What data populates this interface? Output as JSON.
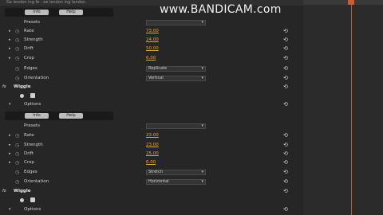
{
  "watermark": "www.BANDICAM.com",
  "header_text": "Ge lendon ing fe - ee lendon ing lendon",
  "reset_glyph": "⟲",
  "twirl_glyph": "▸",
  "twirl_open_glyph": "▾",
  "stopwatch_glyph": "◷",
  "fx_label": "fx",
  "dropdown_arrow": "▾",
  "buttons": {
    "info": "Info",
    "help": "Help"
  },
  "effect1": {
    "presets_label": "Presets",
    "presets_value": "",
    "rate_label": "Rate",
    "rate_value": "73.00",
    "strength_label": "Strength",
    "strength_value": "24.00",
    "drift_label": "Drift",
    "drift_value": "50.00",
    "crop_label": "Crop",
    "crop_value": "6.00",
    "edges_label": "Edges",
    "edges_value": "Replicate",
    "orientation_label": "Orientation",
    "orientation_value": "Vertical"
  },
  "effect2": {
    "name": "Wiggle",
    "options_label": "Options",
    "presets_label": "Presets",
    "presets_value": "",
    "rate_label": "Rate",
    "rate_value": "23.00",
    "strength_label": "Strength",
    "strength_value": "23.00",
    "drift_label": "Drift",
    "drift_value": "25.00",
    "crop_label": "Crop",
    "crop_value": "6.00",
    "edges_label": "Edges",
    "edges_value": "Stretch",
    "orientation_label": "Orientation",
    "orientation_value": "Horizontal"
  },
  "effect3": {
    "name": "Wiggle",
    "options_label": "Options"
  }
}
